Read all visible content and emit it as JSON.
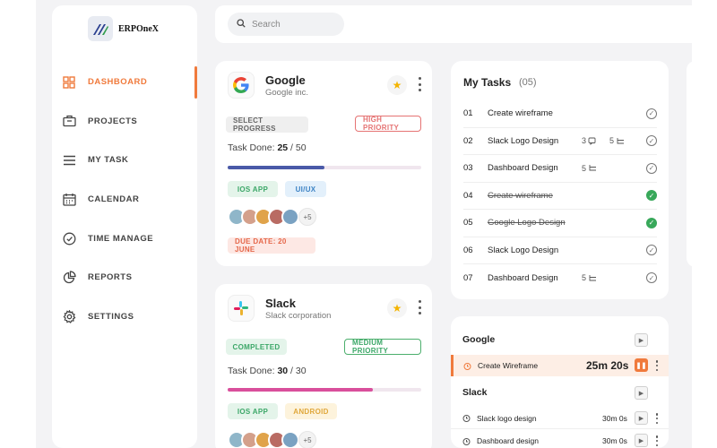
{
  "brand": {
    "name": "ERPOneX"
  },
  "search": {
    "placeholder": "Search"
  },
  "nav": [
    {
      "label": "DASHBOARD",
      "icon": "dashboard-grid-icon",
      "active": true
    },
    {
      "label": "PROJECTS",
      "icon": "briefcase-icon",
      "active": false
    },
    {
      "label": "MY TASK",
      "icon": "list-icon",
      "active": false
    },
    {
      "label": "CALENDAR",
      "icon": "calendar-icon",
      "active": false
    },
    {
      "label": "TIME MANAGE",
      "icon": "clock-icon",
      "active": false
    },
    {
      "label": "REPORTS",
      "icon": "pie-chart-icon",
      "active": false
    },
    {
      "label": "SETTINGS",
      "icon": "gear-icon",
      "active": false
    }
  ],
  "projects": [
    {
      "name": "Google",
      "company": "Google inc.",
      "status": "SELECT PROGRESS",
      "priority": "HIGH PRIORITY",
      "task_label": "Task Done:",
      "done": "25",
      "total": "50",
      "sep": " / ",
      "progress": 0.5,
      "tags": [
        "IOS APP",
        "UI/UX"
      ],
      "more_members": "+5",
      "due": "DUE DATE: 20 JUNE"
    },
    {
      "name": "Slack",
      "company": "Slack corporation",
      "status": "COMPLETED",
      "priority": "MEDIUM PRIORITY",
      "task_label": "Task Done:",
      "done": "30",
      "total": "30",
      "sep": " / ",
      "progress": 0.75,
      "tags": [
        "IOS APP",
        "ANDROID"
      ],
      "more_members": "+5"
    }
  ],
  "my_tasks": {
    "title": "My Tasks",
    "count": "(05)",
    "items": [
      {
        "num": "01",
        "name": "Create wireframe",
        "done": false
      },
      {
        "num": "02",
        "name": "Slack Logo Design",
        "comments": "3",
        "subtasks": "5",
        "done": false
      },
      {
        "num": "03",
        "name": "Dashboard Design",
        "subtasks": "5",
        "done": false
      },
      {
        "num": "04",
        "name": "Create wireframe",
        "done": true
      },
      {
        "num": "05",
        "name": "Google Logo Design",
        "done": true
      },
      {
        "num": "06",
        "name": "Slack Logo Design",
        "done": false
      },
      {
        "num": "07",
        "name": "Dashboard Design",
        "subtasks": "5",
        "done": false
      }
    ]
  },
  "timer": {
    "groups": [
      {
        "name": "Google",
        "tracks": [
          {
            "name": "Create Wireframe",
            "time": "25m 20s",
            "running": true
          }
        ]
      },
      {
        "name": "Slack",
        "tracks": [
          {
            "name": "Slack logo design",
            "time": "30m 0s",
            "running": false
          },
          {
            "name": "Dashboard design",
            "time": "30m 0s",
            "running": false
          }
        ]
      }
    ]
  },
  "colors": {
    "accent": "#f07a3c",
    "google_bar": "#4a5aa8",
    "slack_bar": "#d94f9c",
    "check_green": "#38a85a"
  }
}
